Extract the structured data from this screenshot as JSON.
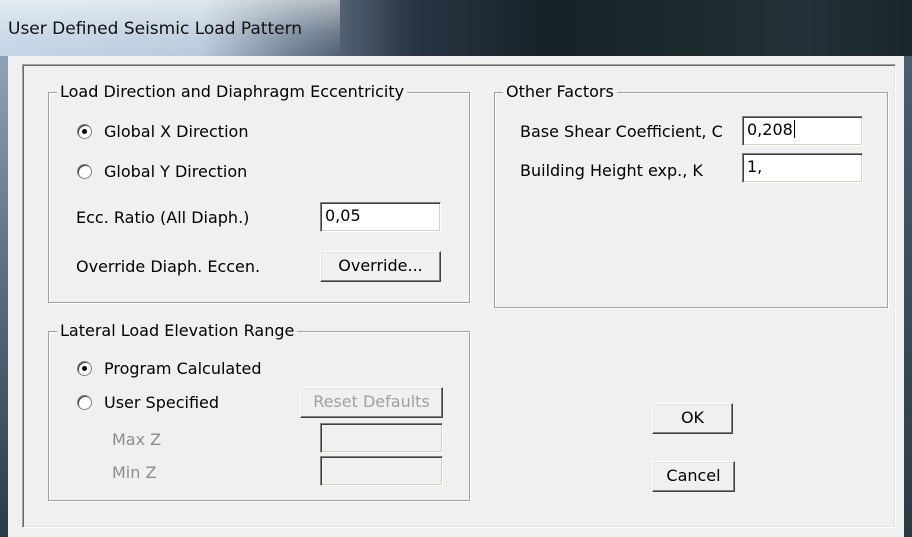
{
  "window": {
    "title": "User Defined Seismic Load Pattern"
  },
  "load_direction": {
    "legend": "Load Direction and Diaphragm Eccentricity",
    "global_x_label": "Global X  Direction",
    "global_x_selected": true,
    "global_y_label": "Global Y  Direction",
    "global_y_selected": false,
    "ecc_ratio_label": "Ecc. Ratio (All Diaph.)",
    "ecc_ratio_value": "0,05",
    "override_label": "Override Diaph. Eccen.",
    "override_button": "Override..."
  },
  "other_factors": {
    "legend": "Other Factors",
    "base_shear_label": "Base Shear Coefficient, C",
    "base_shear_value": "0,208",
    "building_height_label": "Building Height exp., K",
    "building_height_value": "1,"
  },
  "lateral_load": {
    "legend": "Lateral Load Elevation Range",
    "program_calculated_label": "Program Calculated",
    "program_calculated_selected": true,
    "user_specified_label": "User Specified",
    "user_specified_selected": false,
    "reset_defaults_button": "Reset Defaults",
    "max_z_label": "Max Z",
    "max_z_value": "",
    "min_z_label": "Min Z",
    "min_z_value": ""
  },
  "actions": {
    "ok_button": "OK",
    "cancel_button": "Cancel"
  }
}
